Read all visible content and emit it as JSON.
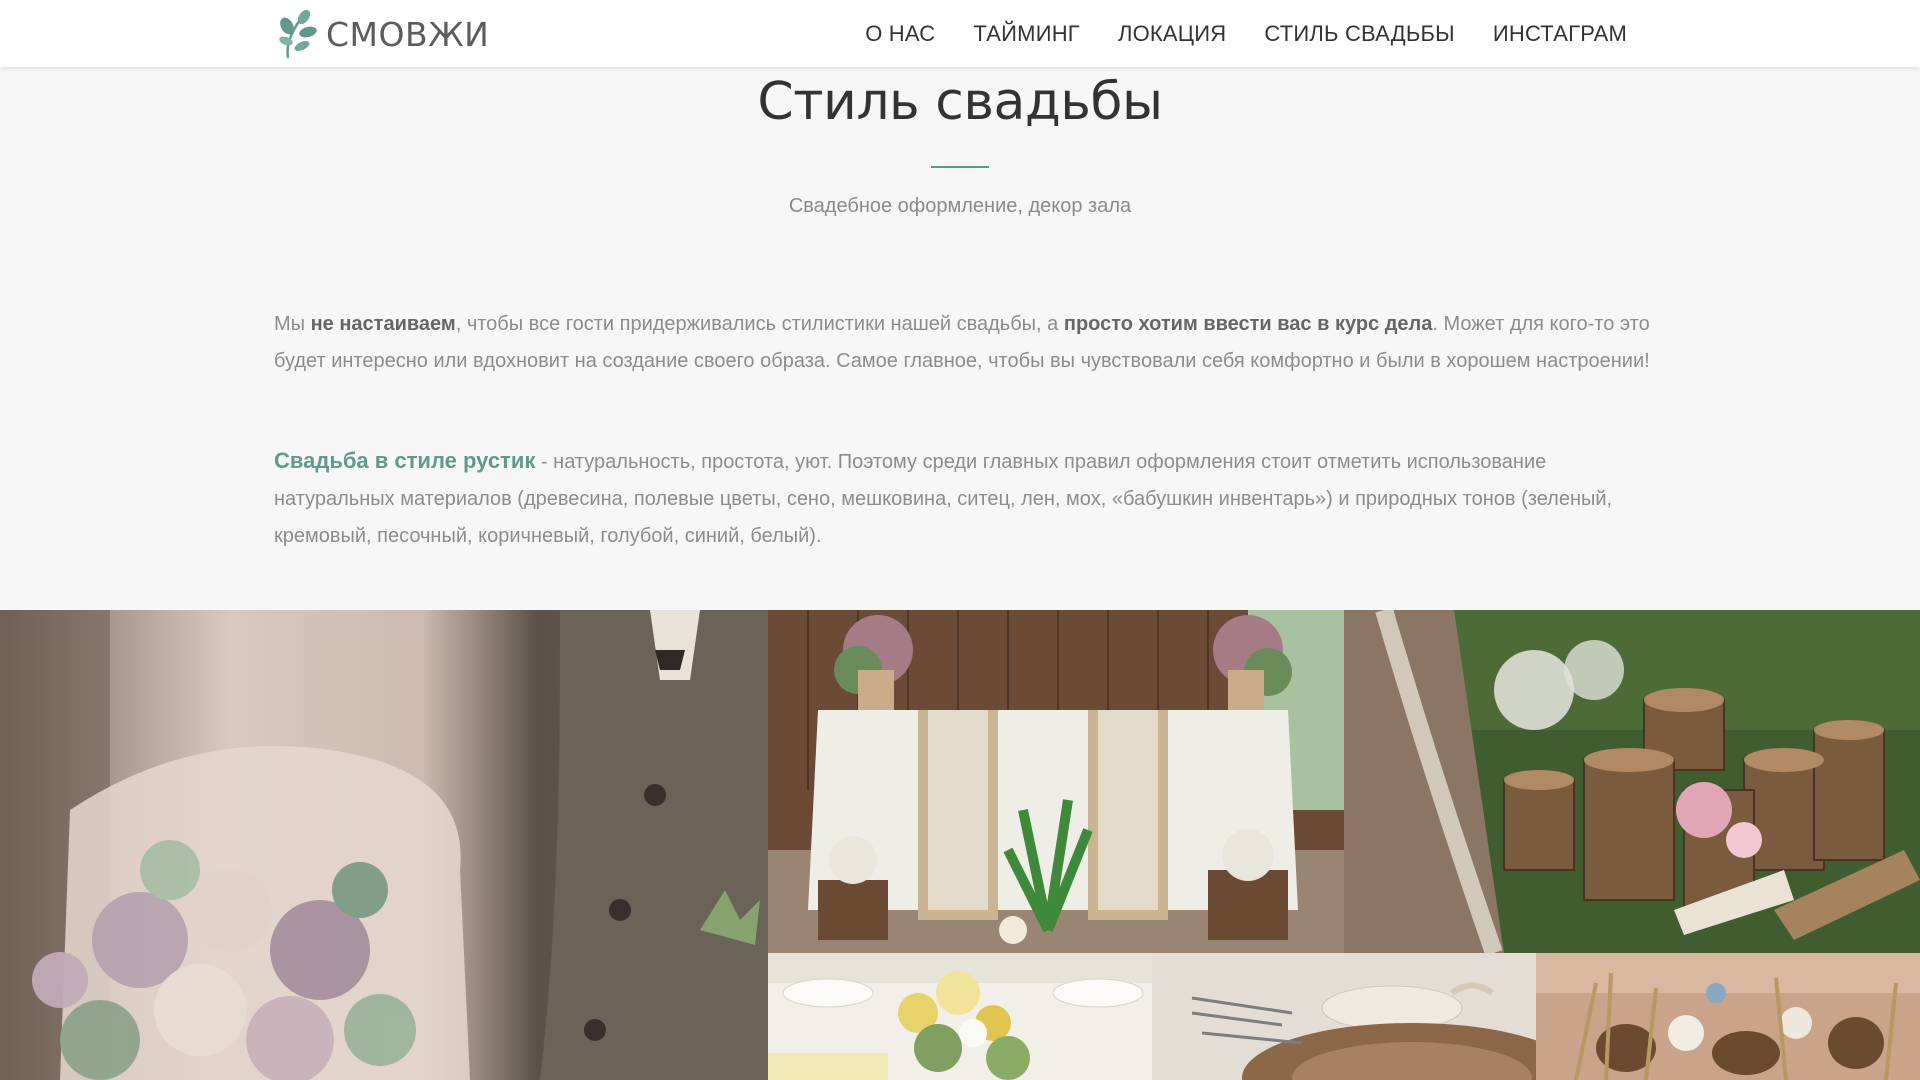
{
  "header": {
    "brand": "СМОВЖИ",
    "nav": [
      "О НАС",
      "ТАЙМИНГ",
      "ЛОКАЦИЯ",
      "СТИЛЬ СВАДЬБЫ",
      "ИНСТАГРАМ"
    ]
  },
  "section": {
    "title": "Стиль свадьбы",
    "subtitle": "Свадебное оформление, декор зала",
    "p1": {
      "t1": "Мы ",
      "b1": "не настаиваем",
      "t2": ", чтобы все гости придерживались стилистики нашей свадьбы, а ",
      "b2": "просто хотим ввести вас в курс дела",
      "t3": ". Может для кого-то это будет интересно или вдохновит на создание своего образа. Самое главное, чтобы вы чувствовали себя комфортно и были в хорошем настроении!"
    },
    "p2": {
      "accent": "Свадьба в стиле рустик",
      "rest": " - натуральность, простота, уют. Поэтому среди главных правил оформления стоит отметить использование натуральных материалов (древесина, полевые цветы, сено, мешковина, ситец, лен, мох, «бабушкин инвентарь») и природных тонов (зеленый, кремовый, песочный, коричневый, голубой, синий, белый)."
    }
  },
  "colors": {
    "accent": "#5f9a8c",
    "header_bg": "#ffffff",
    "page_bg": "#f7f7f7"
  },
  "gallery": {
    "photos": [
      "bride-bouquet",
      "rustic-table",
      "log-decor",
      "yellow-flowers",
      "place-setting",
      "pinecone-decor"
    ]
  }
}
